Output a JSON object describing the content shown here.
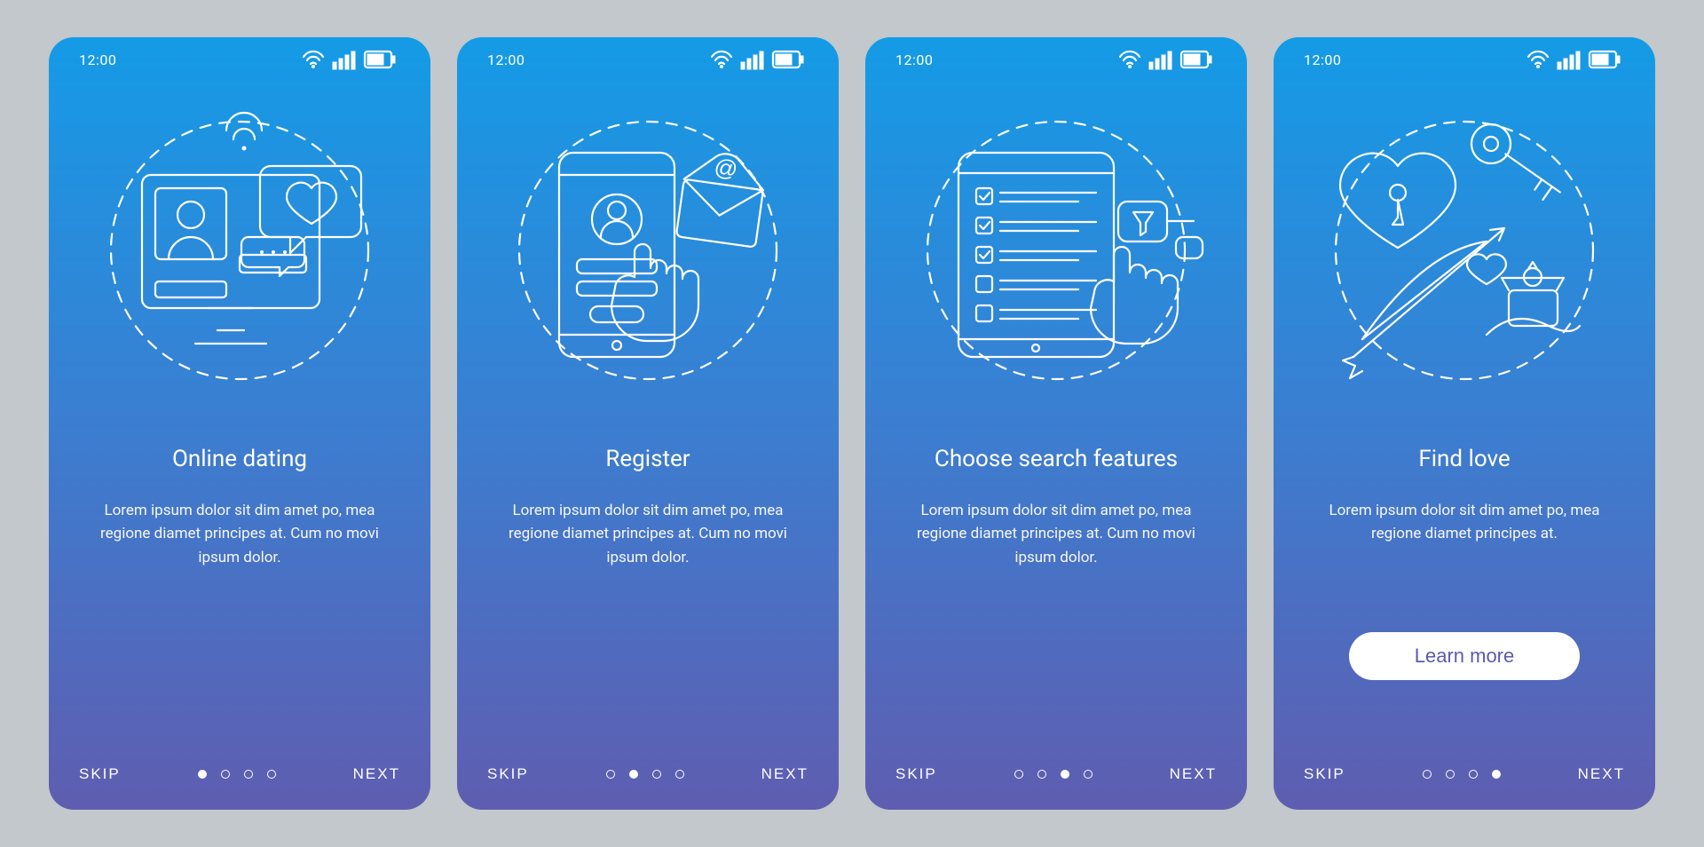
{
  "status_bar": {
    "time": "12:00"
  },
  "pager": {
    "skip_label": "SKIP",
    "next_label": "NEXT",
    "total": 4
  },
  "screens": [
    {
      "title": "Online dating",
      "desc": "Lorem ipsum dolor sit dim amet po, mea regione diamet principes at. Cum no movi ipsum dolor.",
      "icon": "online-dating-icon",
      "active_dot": 0,
      "cta": null
    },
    {
      "title": "Register",
      "desc": "Lorem ipsum dolor sit dim amet po, mea regione diamet principes at. Cum no movi ipsum dolor.",
      "icon": "register-icon",
      "active_dot": 1,
      "cta": null
    },
    {
      "title": "Choose search features",
      "desc": "Lorem ipsum dolor sit dim amet po, mea regione diamet principes at. Cum no movi ipsum dolor.",
      "icon": "search-features-icon",
      "active_dot": 2,
      "cta": null
    },
    {
      "title": "Find love",
      "desc": "Lorem ipsum dolor sit dim amet po, mea regione diamet principes at.",
      "icon": "find-love-icon",
      "active_dot": 3,
      "cta": "Learn more"
    }
  ]
}
